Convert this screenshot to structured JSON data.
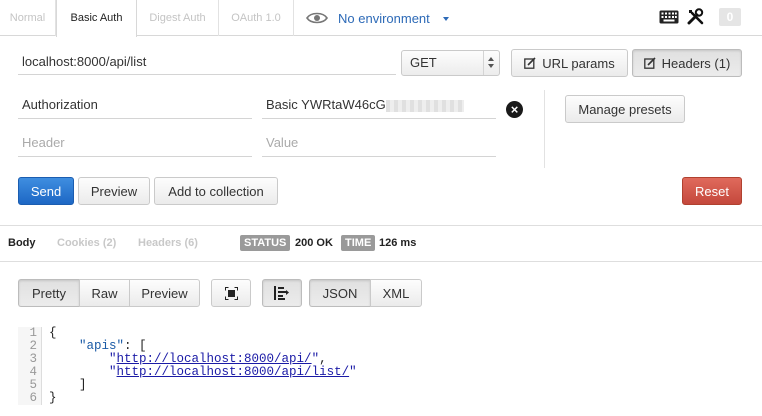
{
  "auth_tabs": [
    {
      "label": "Normal"
    },
    {
      "label": "Basic Auth"
    },
    {
      "label": "Digest Auth"
    },
    {
      "label": "OAuth 1.0"
    }
  ],
  "environment": {
    "label": "No environment"
  },
  "counter": "0",
  "request": {
    "url": "localhost:8000/api/list",
    "method": "GET",
    "url_params_label": "URL params",
    "headers_label": "Headers (1)"
  },
  "headers": {
    "rows": [
      {
        "key": "Authorization",
        "value": "Basic YWRtaW46cG"
      }
    ],
    "key_placeholder": "Header",
    "value_placeholder": "Value",
    "manage_presets_label": "Manage presets"
  },
  "actions": {
    "send": "Send",
    "preview": "Preview",
    "add_to_collection": "Add to collection",
    "reset": "Reset"
  },
  "response": {
    "tabs": [
      {
        "label": "Body"
      },
      {
        "label": "Cookies (2)"
      },
      {
        "label": "Headers (6)"
      }
    ],
    "status_label": "STATUS",
    "status_value": "200 OK",
    "time_label": "TIME",
    "time_value": "126 ms",
    "view_modes": [
      "Pretty",
      "Raw",
      "Preview"
    ],
    "formats": [
      "JSON",
      "XML"
    ],
    "line_numbers": [
      "1",
      "2",
      "3",
      "4",
      "5",
      "6"
    ],
    "code": {
      "open": "{",
      "key": "\"apis\"",
      "colon": ": [",
      "item1": "http://localhost:8000/api/",
      "item2": "http://localhost:8000/api/list/",
      "close_arr": "]",
      "close": "}"
    }
  },
  "colors": {
    "accent": "#2d6ab7",
    "send": "#1d67c4",
    "reset": "#c4483c"
  }
}
